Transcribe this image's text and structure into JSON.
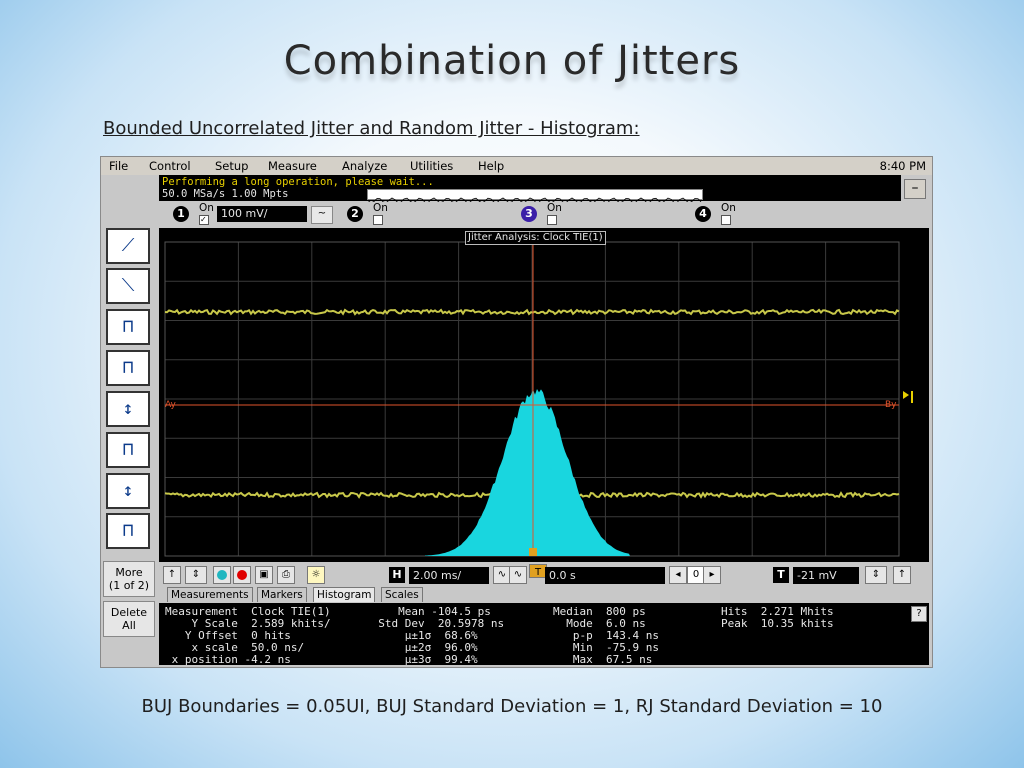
{
  "slide": {
    "title": "Combination of Jitters",
    "subtitle": "Bounded Uncorrelated Jitter and Random Jitter - Histogram:",
    "footer": "BUJ Boundaries = 0.05UI, BUJ Standard Deviation = 1, RJ Standard Deviation = 10"
  },
  "scope": {
    "menu": [
      "File",
      "Control",
      "Setup",
      "Measure",
      "Analyze",
      "Utilities",
      "Help"
    ],
    "clock": "8:40 PM",
    "status": {
      "line1": "Performing a long operation, please wait...",
      "line2": "50.0 MSa/s   1.00 Mpts",
      "minimize": "–"
    },
    "channels": [
      {
        "num": "1",
        "on": "On",
        "checked": "✓",
        "color": "#000000"
      },
      {
        "num": "2",
        "on": "On",
        "checked": "",
        "color": "#000000"
      },
      {
        "num": "3",
        "on": "On",
        "checked": "",
        "color": "#3b1fa8"
      },
      {
        "num": "4",
        "on": "On",
        "checked": "",
        "color": "#000000"
      }
    ],
    "vscale": "100 mV/",
    "coupling": "~",
    "plot": {
      "label": "Jitter Analysis: Clock TIE(1)",
      "marker_a": "Ay",
      "marker_b": "By",
      "trace_color": "#c8c84a",
      "histogram_color": "#19d6df",
      "marker_color": "#e0542c"
    },
    "side": {
      "more_label": "More",
      "more_sub": "(1 of 2)",
      "delete_label": "Delete",
      "delete_sub": "All"
    },
    "controls": {
      "h_label": "H",
      "h_value": "2.00 ms/",
      "t_offset": "0.0 s",
      "center": "0",
      "t_label": "T",
      "trigger": "-21 mV"
    },
    "tabs": [
      "Measurements",
      "Markers",
      "Histogram",
      "Scales"
    ],
    "active_tab": "Histogram",
    "measurements": {
      "col1": [
        "Measurement  Clock TIE(1)",
        "    Y Scale  2.589 khits/",
        "   Y Offset  0 hits",
        "    x scale  50.0 ns/",
        " x position -4.2 ns"
      ],
      "col2": [
        "     Mean -104.5 ps",
        "  Std Dev  20.5978 ns",
        "      μ±1σ  68.6%",
        "      μ±2σ  96.0%",
        "      μ±3σ  99.4%"
      ],
      "col3": [
        "Median  800 ps",
        "  Mode  6.0 ns",
        "   p-p  143.4 ns",
        "   Min  -75.9 ns",
        "   Max  67.5 ns"
      ],
      "col4": [
        "Hits  2.271 Mhits",
        "Peak  10.35 khits"
      ],
      "help": "?"
    }
  }
}
